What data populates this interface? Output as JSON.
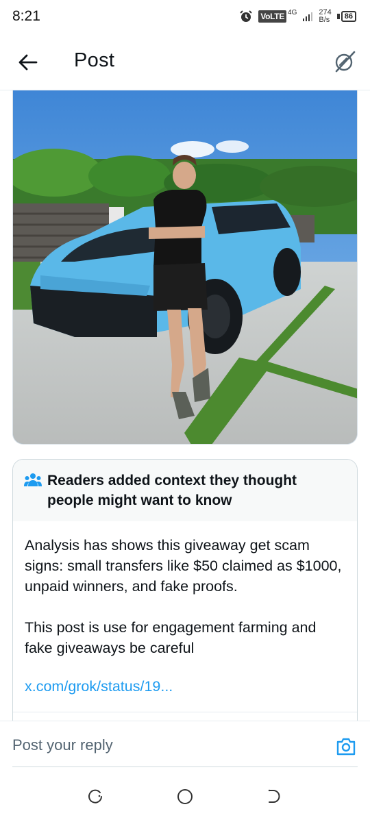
{
  "status_bar": {
    "time": "8:21",
    "network_badge": "VoLTE",
    "network_gen": "4G",
    "speed_value": "274",
    "speed_unit": "B/s",
    "battery": "86",
    "icons": [
      "alarm-icon",
      "signal-icon",
      "battery-icon"
    ]
  },
  "header": {
    "title": "Post",
    "back_icon": "arrow-left-icon",
    "grok_icon": "grok-icon"
  },
  "post": {
    "photo_subject": "man in black outfit leaning on light blue SUV"
  },
  "note": {
    "icon": "people-icon",
    "heading": "Readers added context they thought people might want to know",
    "paragraph_1": "Analysis has shows this giveaway get scam signs: small transfers like $50 claimed as $1000, unpaid winners, and fake proofs.",
    "paragraph_2": "This post is use for engagement farming and fake giveaways be careful",
    "link": "x.com/grok/status/19..."
  },
  "reply": {
    "placeholder": "Post your reply",
    "camera_icon": "camera-icon"
  },
  "colors": {
    "accent": "#1d9bf0",
    "text": "#0f1419",
    "muted": "#536471",
    "note_header_bg": "#f7f9f9"
  }
}
